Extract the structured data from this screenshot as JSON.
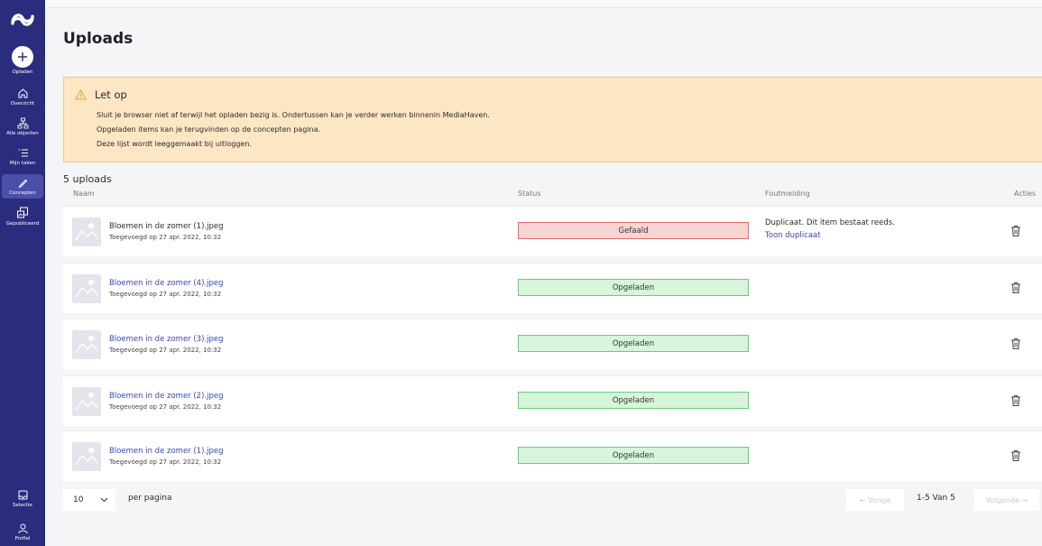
{
  "sidebar": {
    "items": [
      {
        "label": "Opladen",
        "icon": "plus-icon"
      },
      {
        "label": "Overzicht",
        "icon": "home-icon"
      },
      {
        "label": "Alle objecten",
        "icon": "hierarchy-icon"
      },
      {
        "label": "Mijn taken",
        "icon": "tasks-icon"
      },
      {
        "label": "Concepten",
        "icon": "pencil-icon",
        "active": true
      },
      {
        "label": "Gepubliceerd",
        "icon": "published-icon"
      }
    ],
    "bottom": [
      {
        "label": "Selectie",
        "icon": "inbox-icon"
      },
      {
        "label": "Profiel",
        "icon": "user-icon"
      }
    ]
  },
  "page": {
    "title": "Uploads"
  },
  "alert": {
    "title": "Let op",
    "icon": "warning-icon",
    "lines": [
      "Sluit je browser niet af terwijl het opladen bezig is. Ondertussen kan je verder werken binnenin MediaHaven.",
      "Opgeladen items kan je terugvinden op de concepten pagina.",
      "Deze lijst wordt leeggemaakt bij uitloggen."
    ]
  },
  "uploads": {
    "count_label": "5 uploads",
    "columns": {
      "name": "Naam",
      "status": "Status",
      "error": "Foutmelding",
      "actions": "Acties"
    },
    "rows": [
      {
        "name": "Bloemen in de zomer (1).jpeg",
        "date": "Toegevoegd op 27 apr. 2022, 10:32",
        "status": "Gefaald",
        "state": "fail",
        "error": "Duplicaat. Dit item bestaat reeds.",
        "error_link": "Toon duplicaat"
      },
      {
        "name": "Bloemen in de zomer (4).jpeg",
        "date": "Toegevoegd op 27 apr. 2022, 10:32",
        "status": "Opgeladen",
        "state": "ok"
      },
      {
        "name": "Bloemen in de zomer (3).jpeg",
        "date": "Toegevoegd op 27 apr. 2022, 10:32",
        "status": "Opgeladen",
        "state": "ok"
      },
      {
        "name": "Bloemen in de zomer (2).jpeg",
        "date": "Toegevoegd op 27 apr. 2022, 10:32",
        "status": "Opgeladen",
        "state": "ok"
      },
      {
        "name": "Bloemen in de zomer (1).jpeg",
        "date": "Toegevoegd op 27 apr. 2022, 10:32",
        "status": "Opgeladen",
        "state": "ok"
      }
    ]
  },
  "pagination": {
    "per_page_value": "10",
    "per_page_label": "per pagina",
    "prev_label": "← Vorige",
    "info": "1-5 Van 5",
    "next_label": "Volgende →"
  },
  "colors": {
    "sidebar": "#2a2d7e",
    "alert_bg": "#fde6c4",
    "fail_bg": "#f8d4d4",
    "ok_bg": "#d6f5da",
    "link": "#3a46b4"
  }
}
